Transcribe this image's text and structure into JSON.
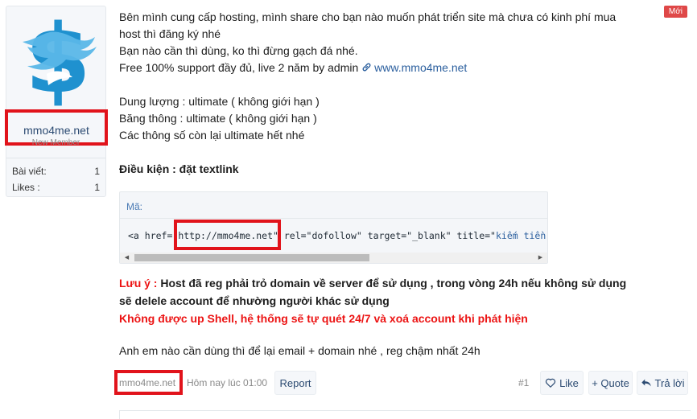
{
  "user": {
    "name": "mmo4me.net",
    "title": "New Member",
    "stats": [
      {
        "label": "Bài viết:",
        "value": "1"
      },
      {
        "label": "Likes :",
        "value": "1"
      }
    ]
  },
  "badge": "Mới",
  "message": {
    "line1": "Bên mình cung cấp hosting, mình share cho bạn nào muốn phát triển site mà chưa có kinh phí mua",
    "line2": "host thì đăng ký nhé",
    "line3": "Bạn nào cần thì dùng, ko thì đừng gạch đá nhé.",
    "line4_prefix": "Free 100% support đầy đủ, live 2 năm by admin",
    "line4_link": "www.mmo4me.net",
    "spec1": "Dung lượng : ultimate ( không giới hạn )",
    "spec2": "Băng thông : ultimate ( không giới hạn )",
    "spec3": "Các thông số còn lại ultimate hết nhé",
    "condition": "Điều kiện : đặt textlink"
  },
  "code": {
    "title": "Mã:",
    "p1": "<a href=\"",
    "url": "http://mmo4me.net",
    "p2": "\" rel=\"dofollow\" target=\"_blank\" title=\"",
    "p3": "kiếm tiền"
  },
  "warning": {
    "label": "Lưu ý :",
    "text1": " Host đã reg phải trỏ domain về server để sử dụng , trong vòng 24h nếu không sử dụng",
    "text2": "sẽ delele account để nhường người khác sử dụng",
    "text3": "Không được up Shell, hệ thống sẽ tự quét 24/7 và xoá account khi phát hiện"
  },
  "closing": "Anh em nào cần dùng thì để lại email + domain nhé , reg chậm nhất 24h",
  "footer": {
    "author": "mmo4me.net",
    "time": "Hôm nay lúc 01:00",
    "report": "Report",
    "post_number": "#1",
    "like": "Like",
    "quote": "+ Quote",
    "reply": "Trả lời"
  }
}
